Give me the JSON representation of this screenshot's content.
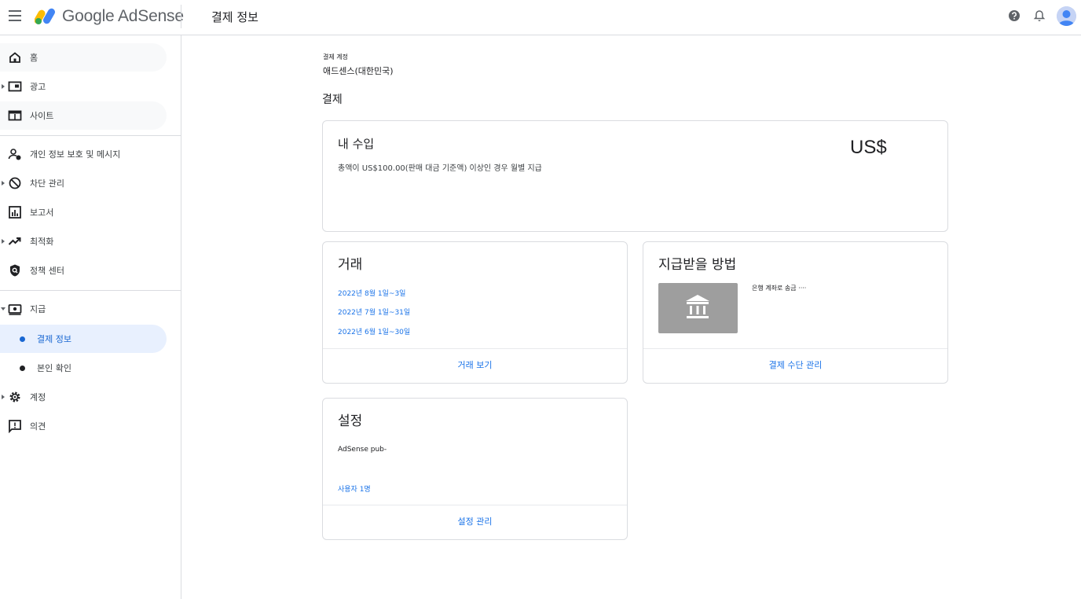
{
  "header": {
    "logo_text": "Google AdSense",
    "page_title": "결제 정보"
  },
  "sidebar": {
    "items": [
      {
        "label": "홈"
      },
      {
        "label": "광고"
      },
      {
        "label": "사이트"
      },
      {
        "label": "개인 정보 보호 및 메시지"
      },
      {
        "label": "차단 관리"
      },
      {
        "label": "보고서"
      },
      {
        "label": "최적화"
      },
      {
        "label": "정책 센터"
      },
      {
        "label": "지급"
      },
      {
        "label": "결제 정보"
      },
      {
        "label": "본인 확인"
      },
      {
        "label": "계정"
      },
      {
        "label": "의견"
      }
    ]
  },
  "main": {
    "account_label": "결제 계정",
    "account_name": "애드센스(대한민국)",
    "section_title": "결제",
    "earnings": {
      "title": "내 수입",
      "description": "총액이 US$100.00(판매 대금 기준액) 이상인 경우 월별 지급",
      "amount": "US$"
    },
    "transactions": {
      "title": "거래",
      "links": [
        "2022년 8월 1일~3일",
        "2022년 7월 1일~31일",
        "2022년 6월 1일~30일"
      ],
      "footer": "거래 보기"
    },
    "payment_method": {
      "title": "지급받을 방법",
      "method_text": "은행 계좌로 송금 ····",
      "footer": "결제 수단 관리"
    },
    "settings": {
      "title": "설정",
      "pub_text": "AdSense pub-",
      "users_link": "사용자 1명",
      "footer": "설정 관리"
    }
  },
  "colors": {
    "accent": "#1a73e8",
    "active_bg": "#e8f0fe",
    "border": "#dadce0"
  }
}
